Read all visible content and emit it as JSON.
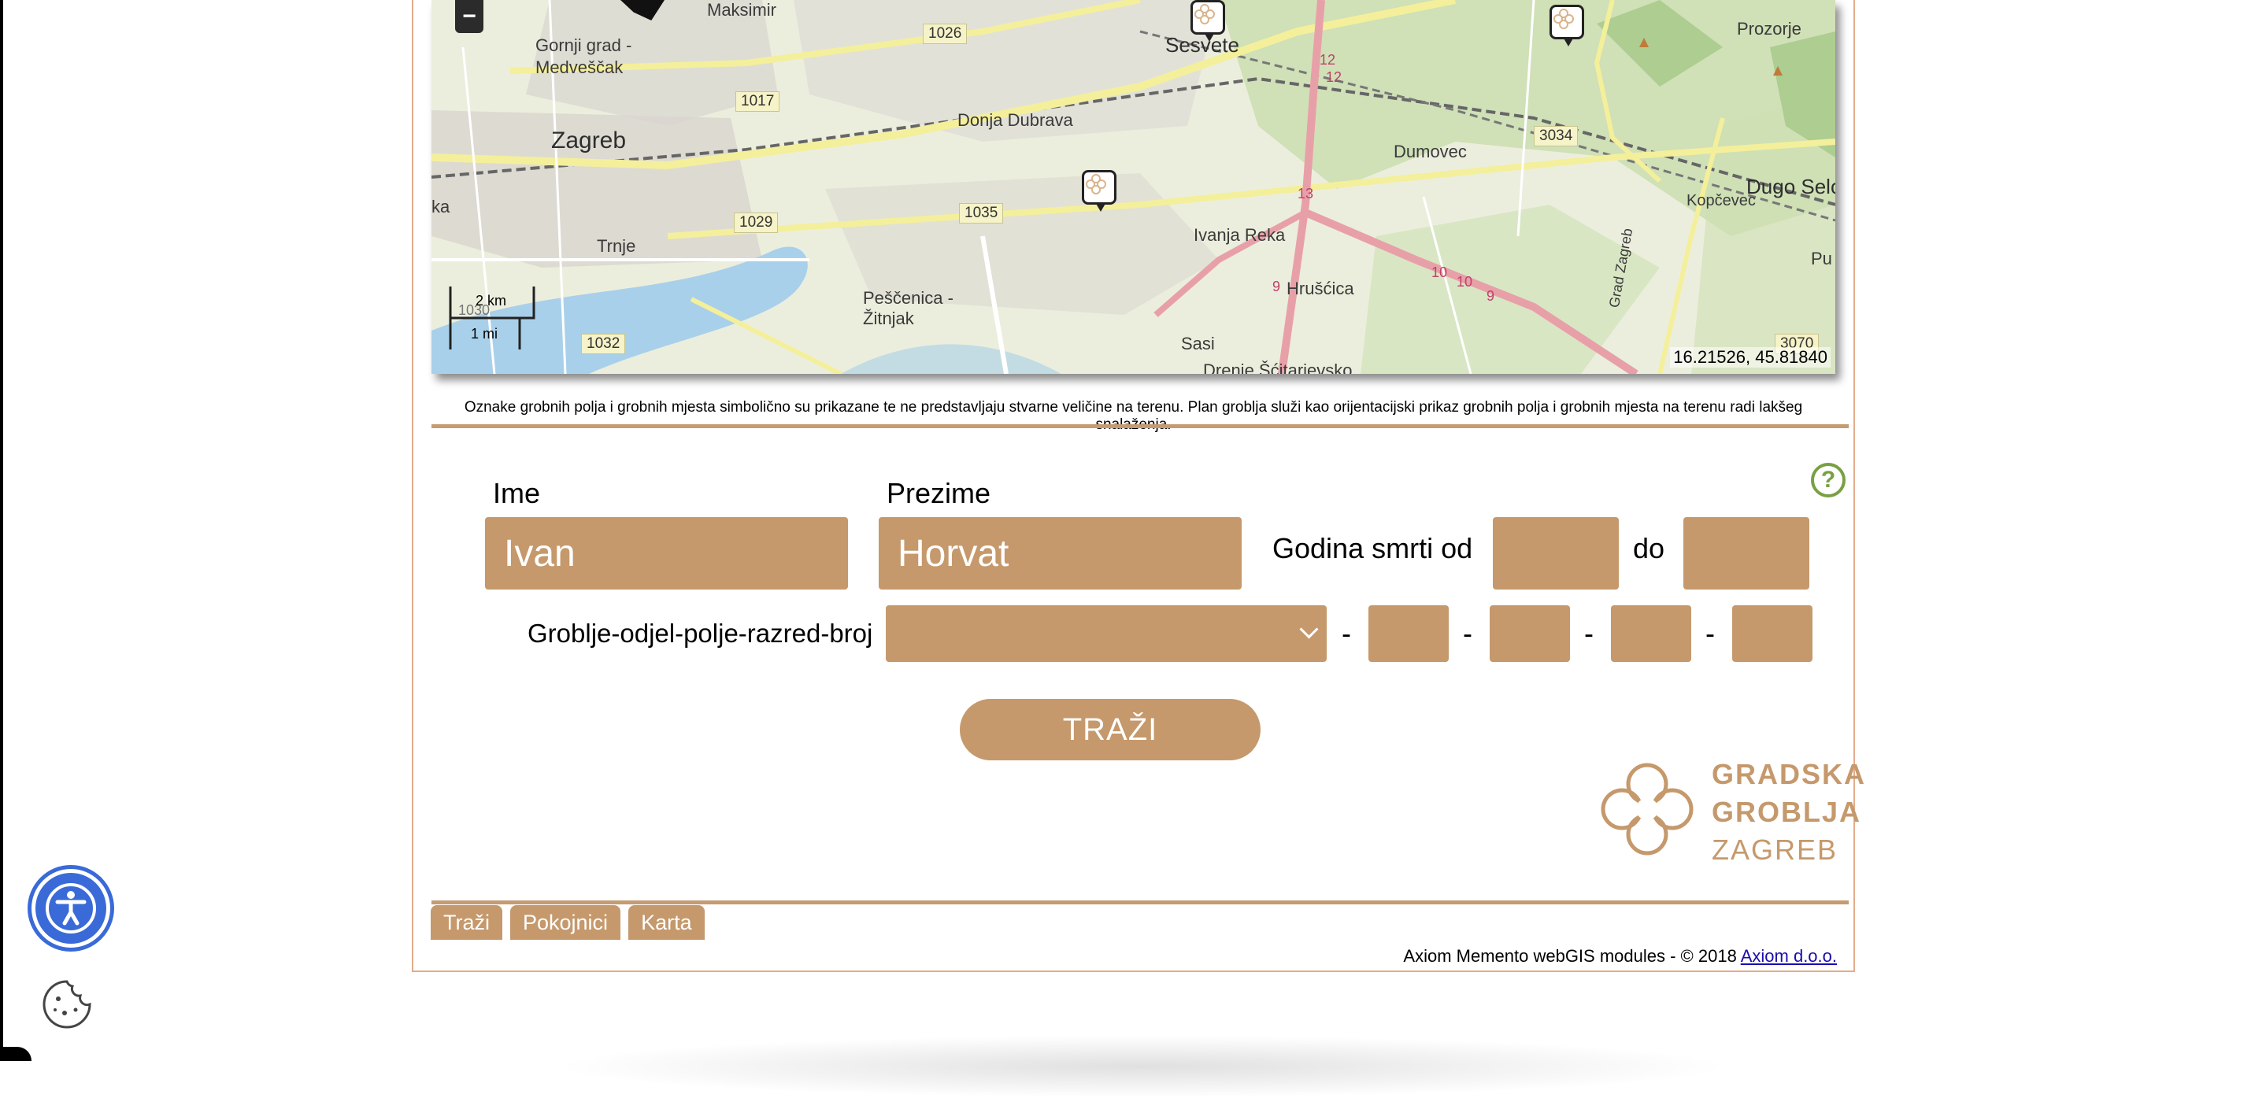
{
  "map": {
    "zoom_out_label": "−",
    "places": [
      "Maksimir",
      "Gornji grad - Medveščak",
      "Zagreb",
      "Trnje",
      "Sesvete",
      "Donja Dubrava",
      "Dumovec",
      "Prozorje",
      "Dugo Selo",
      "Kopčevec",
      "Ivanja Reka",
      "Hrušćica",
      "Peščenica - Žitnjak",
      "Sasi",
      "Drenje Šćitarjevsko",
      "Pu",
      "ka",
      "Grad Zagreb"
    ],
    "roads": [
      "1026",
      "1017",
      "1029",
      "1035",
      "3034",
      "1032",
      "3070",
      "1030",
      "12",
      "12",
      "13",
      "10",
      "10",
      "9",
      "9"
    ],
    "scale_km": "2 km",
    "scale_mi": "1 mi",
    "coordinates": "16.21526, 45.81840"
  },
  "disclaimer": "Oznake grobnih polja i grobnih mjesta simbolično su prikazane te ne predstavljaju stvarne veličine na terenu. Plan groblja služi kao orijentacijski prikaz grobnih polja i grobnih mjesta na terenu radi lakšeg snalaženja.",
  "form": {
    "help_icon": "?",
    "first_name_label": "Ime",
    "first_name_value": "Ivan",
    "last_name_label": "Prezime",
    "last_name_value": "Horvat",
    "year_label": "Godina smrti od",
    "year_to_label": "do",
    "year_from_value": "",
    "year_to_value": "",
    "location_label": "Groblje-odjel-polje-razred-broj",
    "location_select_value": "",
    "dash": "-",
    "search_label": "TRAŽI"
  },
  "logo": {
    "line1": "GRADSKA",
    "line2": "GROBLJA",
    "line3": "ZAGREB",
    "color": "#c5996c"
  },
  "tabs": [
    "Traži",
    "Pokojnici",
    "Karta"
  ],
  "footer": {
    "text": "Axiom Memento webGIS modules - © 2018",
    "link": "Axiom d.o.o."
  },
  "colors": {
    "accent": "#c5996c",
    "border": "#e2ad8b",
    "help": "#78a044",
    "accessibility": "#3a6ad8"
  }
}
